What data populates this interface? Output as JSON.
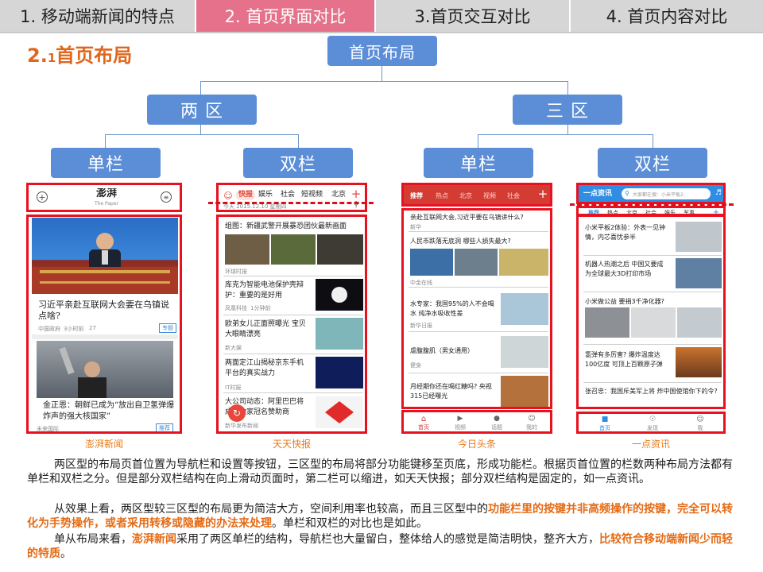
{
  "tabs": [
    {
      "label": "1. 移动端新闻的特点",
      "active": false
    },
    {
      "label": "2. 首页界面对比",
      "active": true
    },
    {
      "label": "3.首页交互对比",
      "active": false
    },
    {
      "label": "4. 首页内容对比",
      "active": false
    }
  ],
  "section": {
    "number": "2.",
    "sub": "1",
    "title": "首页布局"
  },
  "tree": {
    "root": "首页布局",
    "left": "两 区",
    "right": "三 区",
    "leaves": [
      "单栏",
      "双栏",
      "单栏",
      "双栏"
    ]
  },
  "apps": {
    "pengpai": {
      "caption": "澎湃新闻",
      "logo": "澎湃",
      "logo_sub": "The Paper",
      "headline1": "习近平亲赴互联网大会要在乌镇说点啥?",
      "meta1a": "中国政府",
      "meta1b": "3小时前",
      "meta1c": "27",
      "tag1": "专题",
      "headline2": "金正恩：朝鲜已成为“放出自卫氢弹爆炸声的强大核国家”",
      "meta2a": "未来国际",
      "tag2": "推荐"
    },
    "tiantian": {
      "caption": "天天快报",
      "tabs": [
        "快报",
        "娱乐",
        "社会",
        "短视频",
        "北京"
      ],
      "date": "今天 2015.12.10 星期四",
      "item0": "组图：新疆武警开展暴恐团伙最新画面",
      "item0_src": "环球时报",
      "item1": "库克为智能电池保护壳辩护：重要的是好用",
      "item1_src": "凤凰科技",
      "item1_time": "1分钟前",
      "item2": "欧弟女儿正面照曝光 宝贝大眼睛漂亮",
      "item2_src": "新大娱",
      "item3": "两面定江山揭秘京东手机平台的真实战力",
      "item3_src": "IT时报",
      "item4": "大公司动态：阿里巴巴将成杯独家冠名赞助商",
      "item4_src": "新华发布新闻"
    },
    "toutiao": {
      "caption": "今日头条",
      "tabs": [
        "推荐",
        "热点",
        "北京",
        "视频",
        "社会"
      ],
      "item0": "亲赴互联网大会,习近平要在乌镇讲什么?",
      "item0_src": "新华",
      "item1": "人民币跌落无底洞 哪些人损失最大?",
      "item1_src": "中金在线",
      "item2": "水专家：我国95%的人不会喝水 纯净水吸收性差",
      "item2_src": "新华日报",
      "item3": "虐腹腹肌（男女通用）",
      "item3_src": "健身",
      "item4": "月经期你还在喝红糖吗? 央视315已经曝光",
      "bottom": [
        "首页",
        "视频",
        "话题",
        "我的"
      ]
    },
    "yidian": {
      "caption": "一点资讯",
      "brand": "一点资讯",
      "search_placeholder": "大家都在搜：小米平板2",
      "tabs": [
        "推荐",
        "热点",
        "北京",
        "社会",
        "娱乐",
        "军事"
      ],
      "item0": "小米平板2体验：外表一见钟情，内芯喜忧参半",
      "item1": "机器人热潮之后 中国又要成为全球最大3D打印市场",
      "item2": "小米做公益 要捐3千净化器?",
      "item3": "氢弹有多厉害? 爆炸温度达100亿度 可顶上百颗原子弹",
      "item4": "张召忠：我国斥美军上将 炸中国使馆你下的令?",
      "bottom": [
        "首页",
        "发现",
        "我"
      ]
    }
  },
  "paragraphs": {
    "p1": "两区型的布局页首位置为导航栏和设置等按钮，三区型的布局将部分功能键移至页底，形成功能栏。根据页首位置的栏数两种布局方法都有单栏和双栏之分。但是部分双栏结构在向上滑动页面时，第二栏可以缩进，如天天快报；部分双栏结构是固定的，如一点资讯。",
    "p2a": "从效果上看，两区型较三区型的布局更为简洁大方，空间利用率也较高，而且三区型中的",
    "p2b": "功能栏里的按键并非高频操作的按键，完全可以转化为手势操作，或者采用转移或隐藏的办法来处理",
    "p2c": "。单栏和双栏的对比也是如此。",
    "p3a": "单从布局来看，",
    "p3b": "澎湃新闻",
    "p3c": "采用了两区单栏的结构，导航栏也大量留白，整体给人的感觉是简洁明快，整齐大方，",
    "p3d": "比较符合移动端新闻少而轻的特质",
    "p3e": "。"
  },
  "colors": {
    "node": "#5b8ed6",
    "active_tab": "#e5728a",
    "tab": "#d6d6d6",
    "frame": "#e8111f",
    "highlight": "#e36b16",
    "toutiao_red": "#d43c33",
    "yidian_blue": "#2f8ee4"
  }
}
